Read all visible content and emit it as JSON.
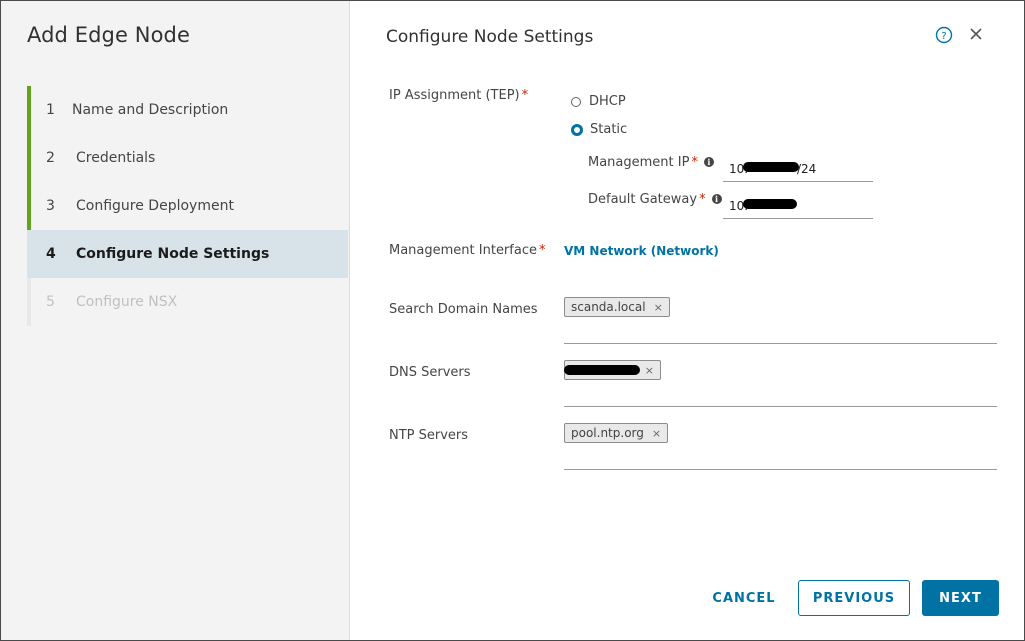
{
  "dialog": {
    "title": "Add Edge Node",
    "section_title": "Configure Node Settings"
  },
  "steps": [
    {
      "num": "1",
      "label": "Name and Description",
      "state": "complete"
    },
    {
      "num": "2",
      "label": "Credentials",
      "state": "complete"
    },
    {
      "num": "3",
      "label": "Configure Deployment",
      "state": "complete"
    },
    {
      "num": "4",
      "label": "Configure Node Settings",
      "state": "active"
    },
    {
      "num": "5",
      "label": "Configure NSX",
      "state": "disabled"
    }
  ],
  "form": {
    "ip_assignment_label": "IP Assignment (TEP)",
    "ip_options": [
      "DHCP",
      "Static"
    ],
    "ip_selected": "Static",
    "management_ip_label": "Management IP",
    "management_ip_prefix": "10.",
    "management_ip_suffix": "/24",
    "default_gateway_label": "Default Gateway",
    "default_gateway_prefix": "10.",
    "management_interface_label": "Management Interface",
    "management_interface_value": "VM Network (Network)",
    "search_domain_label": "Search Domain Names",
    "search_domain_tags": [
      "scanda.local"
    ],
    "dns_servers_label": "DNS Servers",
    "ntp_servers_label": "NTP Servers",
    "ntp_servers_tags": [
      "pool.ntp.org"
    ],
    "required_mark": "*"
  },
  "icons": {
    "help": "help-circle-icon",
    "close": "close-icon",
    "info": "info-icon",
    "tag_remove": "×"
  },
  "footer": {
    "cancel": "CANCEL",
    "previous": "PREVIOUS",
    "next": "NEXT"
  },
  "colors": {
    "accent": "#0072a3",
    "step_complete": "#62a420",
    "active_step_bg": "#d8e3e9",
    "required": "#c92100"
  }
}
